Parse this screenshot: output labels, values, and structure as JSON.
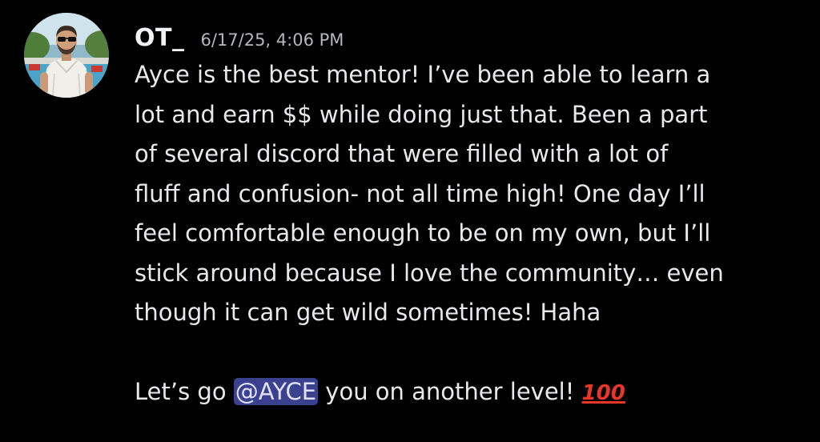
{
  "message": {
    "author": "OT_",
    "timestamp": "6/17/25, 4:06 PM",
    "avatar_icon": "profile-photo",
    "lines": [
      "Ayce is the best mentor! I’ve been able to learn a",
      "lot and earn $$ while doing just that. Been a part",
      "of several discord that were filled with a lot of",
      "fluff and confusion- not all time high! One day I’ll",
      "feel comfortable enough to be on my own, but I’ll",
      "stick around because I love the community… even",
      "though it can get wild sometimes! Haha"
    ],
    "last_line": {
      "prefix": "Let’s go ",
      "mention": "@AYCE",
      "suffix": " you on another level! ",
      "emoji": "100",
      "emoji_name": "hundred-points-icon"
    }
  },
  "colors": {
    "background": "#000000",
    "text": "#e9e9ec",
    "timestamp": "#b5b7bc",
    "mention_bg": "#3c418f",
    "emoji": "#e8372a"
  }
}
